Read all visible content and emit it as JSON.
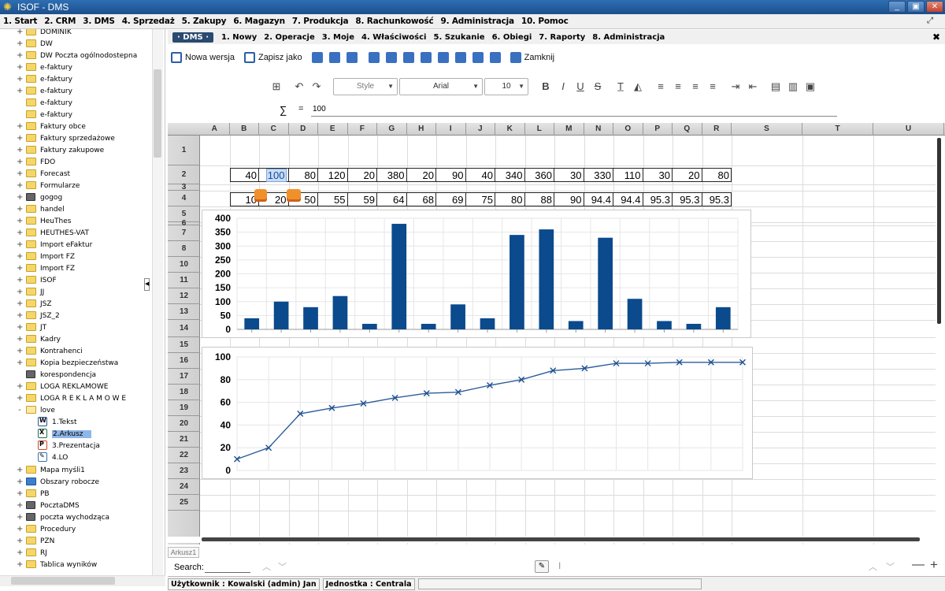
{
  "window": {
    "title": "ISOF - DMS",
    "min": "_",
    "max": "▣",
    "close": "✕"
  },
  "main_menu": [
    "1. Start",
    "2. CRM",
    "3. DMS",
    "4. Sprzedaż",
    "5. Zakupy",
    "6. Magazyn",
    "7. Produkcja",
    "8. Rachunkowość",
    "9. Administracja",
    "10. Pomoc"
  ],
  "main_menu_right": "⤢",
  "sidebar": {
    "items": [
      {
        "label": "DOMINIK",
        "toggle": "+",
        "icon": "folder-icon"
      },
      {
        "label": "DW",
        "toggle": "+",
        "icon": "folder-icon"
      },
      {
        "label": "DW Poczta ogólnodostepna",
        "toggle": "+",
        "icon": "folder-icon"
      },
      {
        "label": "e-faktury",
        "toggle": "+",
        "icon": "folder-icon"
      },
      {
        "label": "e-faktury",
        "toggle": "+",
        "icon": "folder-icon"
      },
      {
        "label": "e-faktury",
        "toggle": "+",
        "icon": "folder-icon"
      },
      {
        "label": "e-faktury",
        "toggle": "",
        "icon": "folder-icon"
      },
      {
        "label": "e-faktury",
        "toggle": "",
        "icon": "folder-icon"
      },
      {
        "label": "Faktury obce",
        "toggle": "+",
        "icon": "folder-icon"
      },
      {
        "label": "Faktury sprzedażowe",
        "toggle": "+",
        "icon": "folder-icon"
      },
      {
        "label": "Faktury zakupowe",
        "toggle": "+",
        "icon": "folder-icon"
      },
      {
        "label": "FDO",
        "toggle": "+",
        "icon": "folder-icon"
      },
      {
        "label": "Forecast",
        "toggle": "+",
        "icon": "folder-icon"
      },
      {
        "label": "Formularze",
        "toggle": "+",
        "icon": "folder-icon"
      },
      {
        "label": "gogog",
        "toggle": "+",
        "icon": "device-icon"
      },
      {
        "label": "handel",
        "toggle": "+",
        "icon": "folder-icon"
      },
      {
        "label": "HeuThes",
        "toggle": "+",
        "icon": "folder-icon"
      },
      {
        "label": "HEUTHES-VAT",
        "toggle": "+",
        "icon": "folder-icon"
      },
      {
        "label": "Import eFaktur",
        "toggle": "+",
        "icon": "folder-icon"
      },
      {
        "label": "Import FZ",
        "toggle": "+",
        "icon": "folder-icon"
      },
      {
        "label": "Import FZ",
        "toggle": "+",
        "icon": "folder-icon"
      },
      {
        "label": "ISOF",
        "toggle": "+",
        "icon": "folder-icon"
      },
      {
        "label": "JJ",
        "toggle": "+",
        "icon": "folder-icon"
      },
      {
        "label": "JSZ",
        "toggle": "+",
        "icon": "folder-icon"
      },
      {
        "label": "JSZ_2",
        "toggle": "+",
        "icon": "folder-icon"
      },
      {
        "label": "JT",
        "toggle": "+",
        "icon": "folder-icon"
      },
      {
        "label": "Kadry",
        "toggle": "+",
        "icon": "folder-icon"
      },
      {
        "label": "Kontrahenci",
        "toggle": "+",
        "icon": "folder-icon"
      },
      {
        "label": "Kopia bezpieczeństwa",
        "toggle": "+",
        "icon": "folder-icon"
      },
      {
        "label": "korespondencja",
        "toggle": "",
        "icon": "device-icon"
      },
      {
        "label": "LOGA REKLAMOWE",
        "toggle": "+",
        "icon": "folder-icon"
      },
      {
        "label": "LOGA R E K L A M O W E",
        "toggle": "+",
        "icon": "folder-icon"
      },
      {
        "label": "love",
        "toggle": "-",
        "icon": "folder-open-icon"
      }
    ],
    "children": [
      {
        "label": "1.Tekst",
        "icon": "word-doc-icon",
        "ch": "W",
        "cls": "w"
      },
      {
        "label": "2.Arkusz",
        "icon": "excel-sheet-icon",
        "ch": "X",
        "cls": "x",
        "selected": true
      },
      {
        "label": "3.Prezentacja",
        "icon": "presentation-icon",
        "ch": "P",
        "cls": "p"
      },
      {
        "label": "4.LO",
        "icon": "lo-doc-icon",
        "ch": "✎",
        "cls": "l"
      }
    ],
    "items_after": [
      {
        "label": "Mapa myśli1",
        "toggle": "+",
        "icon": "folder-icon"
      },
      {
        "label": "Obszary robocze",
        "toggle": "+",
        "icon": "home-icon"
      },
      {
        "label": "PB",
        "toggle": "+",
        "icon": "folder-icon"
      },
      {
        "label": "PocztaDMS",
        "toggle": "+",
        "icon": "device-icon"
      },
      {
        "label": "poczta wychodząca",
        "toggle": "+",
        "icon": "device-icon"
      },
      {
        "label": "Procedury",
        "toggle": "+",
        "icon": "folder-icon"
      },
      {
        "label": "PZN",
        "toggle": "+",
        "icon": "folder-icon"
      },
      {
        "label": "RJ",
        "toggle": "+",
        "icon": "folder-icon"
      },
      {
        "label": "Tablica wyników",
        "toggle": "+",
        "icon": "folder-icon"
      }
    ]
  },
  "sub_menu": {
    "dms": "· DMS ·",
    "items": [
      "1. Nowy",
      "2. Operacje",
      "3. Moje",
      "4. Właściwości",
      "5. Szukanie",
      "6. Obiegi",
      "7. Raporty",
      "8. Administracja"
    ],
    "close": "✖"
  },
  "toolbar": {
    "new_version": "Nowa wersja",
    "save_as": "Zapisz jako",
    "close": "Zamknij"
  },
  "format_toolbar": {
    "style": "Style",
    "font": "Arial",
    "size": "10",
    "bold": "B",
    "italic": "I",
    "underline": "U",
    "strike": "S"
  },
  "formula_bar": {
    "sigma": "∑",
    "eq": "=",
    "value": "100"
  },
  "sheet": {
    "columns": [
      "A",
      "B",
      "C",
      "D",
      "E",
      "F",
      "G",
      "H",
      "I",
      "J",
      "K",
      "L",
      "M",
      "N",
      "O",
      "P",
      "Q",
      "R",
      "S",
      "T",
      "U"
    ],
    "rows": [
      "1",
      "2",
      "3",
      "4",
      "5",
      "6",
      "7",
      "8",
      "10",
      "11",
      "12",
      "13",
      "14",
      "15",
      "16",
      "17",
      "18",
      "19",
      "20",
      "21",
      "22",
      "23",
      "24",
      "25"
    ],
    "row2": [
      "40",
      "100",
      "80",
      "120",
      "20",
      "380",
      "20",
      "90",
      "40",
      "340",
      "360",
      "30",
      "330",
      "110",
      "30",
      "20",
      "80"
    ],
    "row4": [
      "10",
      "20",
      "50",
      "55",
      "59",
      "64",
      "68",
      "69",
      "75",
      "80",
      "88",
      "90",
      "94.4",
      "94.4",
      "95.3",
      "95.3",
      "95.3"
    ],
    "tab": "Arkusz1"
  },
  "chart_data": [
    {
      "type": "bar",
      "title": "",
      "xlabel": "",
      "ylabel": "",
      "ylim": [
        0,
        400
      ],
      "yticks": [
        0,
        50,
        100,
        150,
        200,
        250,
        300,
        350,
        400
      ],
      "values": [
        40,
        100,
        80,
        120,
        20,
        380,
        20,
        90,
        40,
        340,
        360,
        30,
        330,
        110,
        30,
        20,
        80
      ],
      "color": "#0b4a8c",
      "grid": true
    },
    {
      "type": "line",
      "title": "",
      "xlabel": "",
      "ylabel": "",
      "ylim": [
        0,
        100
      ],
      "yticks": [
        0,
        20,
        40,
        60,
        80,
        100
      ],
      "values": [
        10,
        20,
        50,
        55,
        59,
        64,
        68,
        69,
        75,
        80,
        88,
        90,
        94.4,
        94.4,
        95.3,
        95.3,
        95.3
      ],
      "color": "#2a5c9a",
      "marker": "x",
      "grid": true
    }
  ],
  "search": {
    "label": "Search:",
    "value": ""
  },
  "status": {
    "user": "Użytkownik : Kowalski (admin) Jan",
    "unit": "Jednostka : Centrala"
  },
  "colors": {
    "accent": "#1b4f8c",
    "bar": "#0b4a8c",
    "line": "#2a5c9a"
  }
}
